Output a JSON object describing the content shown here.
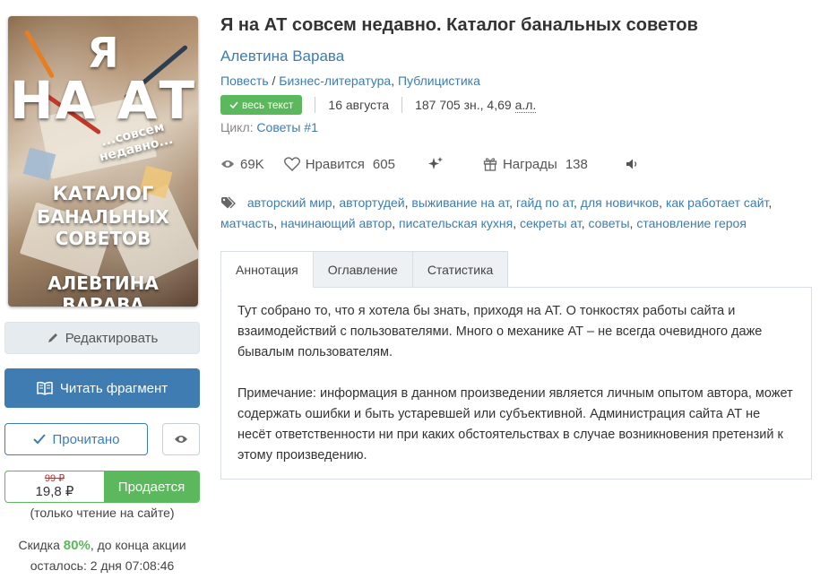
{
  "cover": {
    "line1": "Я",
    "line2": "НА АТ",
    "line3": "...совсем недавно...",
    "line4": "КАТАЛОГ",
    "line5": "БАНАЛЬНЫХ СОВЕТОВ",
    "line6": "АЛЕВТИНА ВАРАВА"
  },
  "sidebar": {
    "edit_label": "Редактировать",
    "read_fragment_label": "Читать фрагмент",
    "read_done_label": "Прочитано",
    "old_price": "99 ₽",
    "new_price": "19,8 ₽",
    "sale_label": "Продается",
    "only_site": "(только чтение на сайте)",
    "discount_prefix": "Скидка",
    "discount_value": "80%",
    "discount_suffix": ", до конца акции",
    "remaining": "осталось: 2 дня 07:08:46"
  },
  "book": {
    "title": "Я на АТ совсем недавно. Каталог банальных советов",
    "author": "Алевтина Варава",
    "form": "Повесть",
    "genre_sep": " / ",
    "genre1": "Бизнес-литература",
    "genre_comma": ", ",
    "genre2": "Публицистика",
    "full_text_badge": "весь текст",
    "date": "16 августа",
    "size": "187 705 зн., 4,69",
    "size_unit": "а.л.",
    "series_prefix": "Цикл:",
    "series": "Советы #1"
  },
  "stats": {
    "views": "69K",
    "likes_label": "Нравится",
    "likes": "605",
    "awards_label": "Награды",
    "awards": "138"
  },
  "tags": [
    "авторский мир",
    "автортудей",
    "выживание на ат",
    "гайд по ат",
    "для новичков",
    "как работает сайт",
    "матчасть",
    "начинающий автор",
    "писательская кухня",
    "секреты ат",
    "советы",
    "становление героя"
  ],
  "tabs": {
    "annotation": "Аннотация",
    "toc": "Оглавление",
    "stats": "Статистика"
  },
  "annotation": {
    "p1": "Тут собрано то, что я хотела бы знать, приходя на АТ. О тонкостях работы сайта и взаимодействий с пользователями. Много о механике АТ – не всегда очевидного даже бывалым пользователям.",
    "p2": "Примечание: информация в данном произведении является личным опытом автора, может содержать ошибки и быть устаревшей или субъективной. Администрация сайта АТ не несёт ответственности ни при каких обстоятельствах в случае возникновения претензий к этому произведению."
  },
  "colors": {
    "link": "#3e7cb1",
    "green": "#5cb85c",
    "primary_button": "#3e7cb1"
  }
}
